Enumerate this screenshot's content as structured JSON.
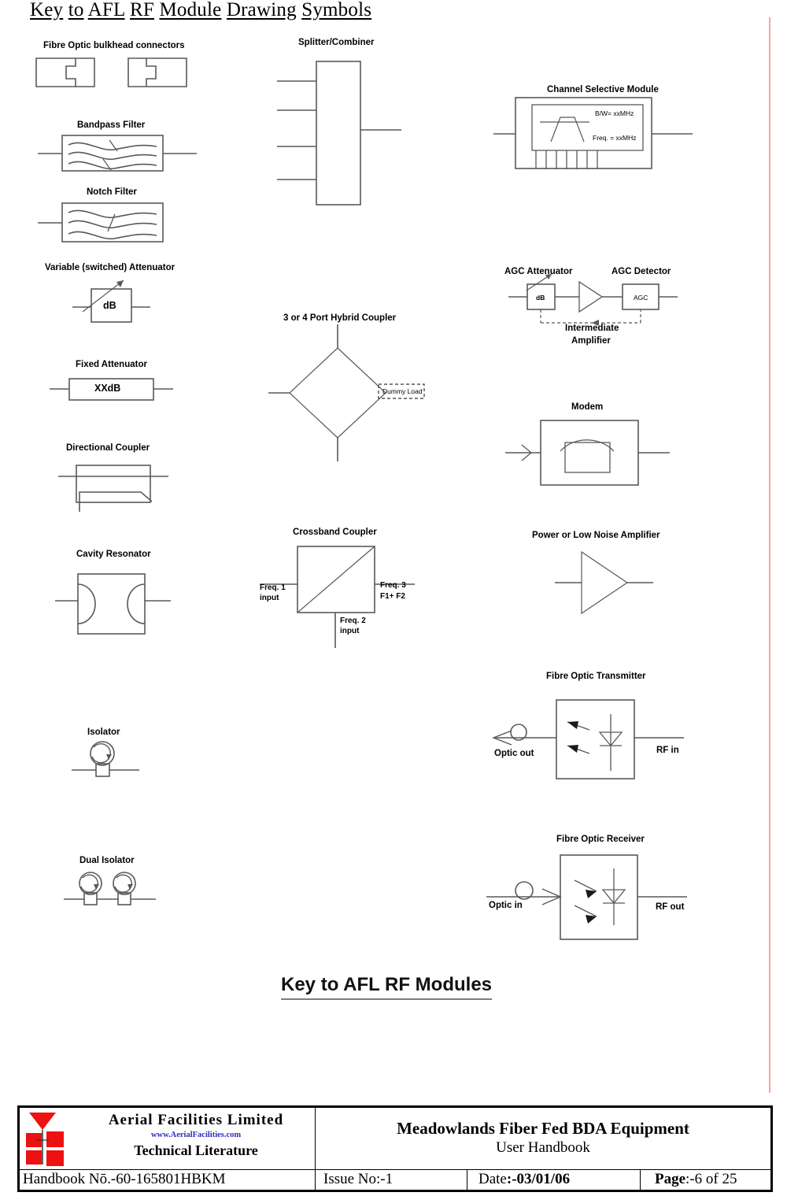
{
  "document": {
    "title": "Key to AFL RF Module Drawing Symbols",
    "title_words": [
      "Key",
      "to",
      "AFL",
      "RF",
      "Module",
      "Drawing",
      "Symbols"
    ],
    "caption": "Key to AFL RF Modules"
  },
  "symbols": {
    "fibre_optic_bulkhead_connectors": {
      "label": "Fibre Optic bulkhead connectors"
    },
    "bandpass_filter": {
      "label": "Bandpass Filter"
    },
    "notch_filter": {
      "label": "Notch Filter"
    },
    "variable_attenuator": {
      "label": "Variable (switched) Attenuator",
      "box_text": "dB"
    },
    "fixed_attenuator": {
      "label": "Fixed Attenuator",
      "box_text": "XXdB"
    },
    "directional_coupler": {
      "label": "Directional Coupler"
    },
    "cavity_resonator": {
      "label": "Cavity Resonator"
    },
    "isolator": {
      "label": "Isolator"
    },
    "dual_isolator": {
      "label": "Dual Isolator"
    },
    "splitter_combiner": {
      "label": "Splitter/Combiner"
    },
    "hybrid_coupler": {
      "label": "3 or 4 Port Hybrid Coupler",
      "dummy_load": "Dummy Load"
    },
    "crossband_coupler": {
      "label": "Crossband Coupler",
      "port_left": "Freq. 1\ninput",
      "port_left_l1": "Freq. 1",
      "port_left_l2": "input",
      "port_right_l1": "Freq. 3",
      "port_right_l2": "F1+ F2",
      "port_bottom_l1": "Freq. 2",
      "port_bottom_l2": "input"
    },
    "channel_selective_module": {
      "label": "Channel Selective Module",
      "bw_text": "B/W= xxMHz",
      "freq_text": "Freq. = xxMHz"
    },
    "agc_attenuator": {
      "label": "AGC Attenuator",
      "box_text": "dB"
    },
    "agc_detector": {
      "label": "AGC Detector",
      "box_text": "AGC"
    },
    "intermediate_amplifier": {
      "label_l1": "Intermediate",
      "label_l2": "Amplifier"
    },
    "modem": {
      "label": "Modem"
    },
    "power_amplifier": {
      "label": "Power or Low Noise Amplifier"
    },
    "fibre_optic_transmitter": {
      "label": "Fibre Optic Transmitter",
      "optic_port": "Optic out",
      "rf_port": "RF in"
    },
    "fibre_optic_receiver": {
      "label": "Fibre Optic Receiver",
      "optic_port": "Optic in",
      "rf_port": "RF out"
    }
  },
  "footer": {
    "company": "Aerial  Facilities  Limited",
    "website": "www.AerialFacilities.com",
    "literature": "Technical Literature",
    "equipment_title": "Meadowlands Fiber Fed BDA Equipment",
    "equipment_subtitle": "User Handbook",
    "handbook_no": "Handbook Nō.-60-165801HBKM",
    "issue_no_label": "Issue No:-",
    "issue_no_value": "1",
    "date_label": "Date",
    "date_value": ":-03/01/06",
    "page_label": "Page",
    "page_value": ":-6 of 25"
  },
  "colors": {
    "line": "#595959",
    "logo_red": "#ee1111",
    "logo_blue": "#2c2cc0",
    "margin_rule": "#f3a6a6"
  }
}
